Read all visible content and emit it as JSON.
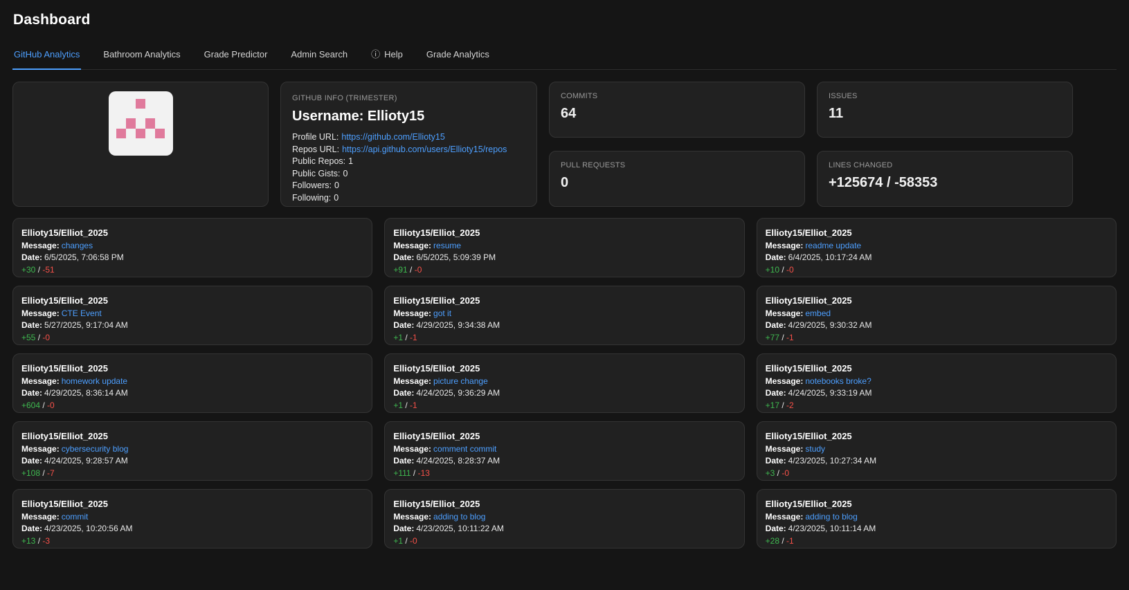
{
  "page": {
    "title": "Dashboard"
  },
  "icons": {
    "info": "ⓘ"
  },
  "tabs": [
    {
      "label": "GitHub Analytics",
      "active": true
    },
    {
      "label": "Bathroom Analytics"
    },
    {
      "label": "Grade Predictor"
    },
    {
      "label": "Admin Search"
    },
    {
      "label": "Help",
      "icon": "info"
    },
    {
      "label": "Grade Analytics"
    }
  ],
  "avatar": {
    "pattern": [
      [
        0,
        0,
        1,
        0,
        0
      ],
      [
        0,
        0,
        0,
        0,
        0
      ],
      [
        0,
        1,
        0,
        1,
        0
      ],
      [
        1,
        0,
        1,
        0,
        1
      ],
      [
        0,
        0,
        0,
        0,
        0
      ]
    ]
  },
  "github_info": {
    "card_label": "GITHUB INFO (TRIMESTER)",
    "username": "Username: Ellioty15",
    "fields": [
      {
        "label": "Profile URL:",
        "value": "https://github.com/Ellioty15",
        "is_link": true
      },
      {
        "label": "Repos URL:",
        "value": "https://api.github.com/users/Ellioty15/repos",
        "is_link": true
      },
      {
        "label": "Public Repos:",
        "value": "1"
      },
      {
        "label": "Public Gists:",
        "value": "0"
      },
      {
        "label": "Followers:",
        "value": "0"
      },
      {
        "label": "Following:",
        "value": "0"
      }
    ]
  },
  "stats": [
    {
      "label": "COMMITS",
      "value": "64"
    },
    {
      "label": "PULL REQUESTS",
      "value": "0"
    },
    {
      "label": "ISSUES",
      "value": "11"
    },
    {
      "label": "LINES CHANGED",
      "value": "+125674 / -58353"
    }
  ],
  "commit_labels": {
    "message": "Message:",
    "date": "Date:",
    "separator": "/"
  },
  "commits": [
    {
      "repo": "Ellioty15/Elliot_2025",
      "message": "changes",
      "date": "6/5/2025, 7:06:58 PM",
      "additions": "+30",
      "deletions": "-51"
    },
    {
      "repo": "Ellioty15/Elliot_2025",
      "message": "resume",
      "date": "6/5/2025, 5:09:39 PM",
      "additions": "+91",
      "deletions": "-0"
    },
    {
      "repo": "Ellioty15/Elliot_2025",
      "message": "readme update",
      "date": "6/4/2025, 10:17:24 AM",
      "additions": "+10",
      "deletions": "-0"
    },
    {
      "repo": "Ellioty15/Elliot_2025",
      "message": "CTE Event",
      "date": "5/27/2025, 9:17:04 AM",
      "additions": "+55",
      "deletions": "-0"
    },
    {
      "repo": "Ellioty15/Elliot_2025",
      "message": "got it",
      "date": "4/29/2025, 9:34:38 AM",
      "additions": "+1",
      "deletions": "-1"
    },
    {
      "repo": "Ellioty15/Elliot_2025",
      "message": "embed",
      "date": "4/29/2025, 9:30:32 AM",
      "additions": "+77",
      "deletions": "-1"
    },
    {
      "repo": "Ellioty15/Elliot_2025",
      "message": "homework update",
      "date": "4/29/2025, 8:36:14 AM",
      "additions": "+604",
      "deletions": "-0"
    },
    {
      "repo": "Ellioty15/Elliot_2025",
      "message": "picture change",
      "date": "4/24/2025, 9:36:29 AM",
      "additions": "+1",
      "deletions": "-1"
    },
    {
      "repo": "Ellioty15/Elliot_2025",
      "message": "notebooks broke?",
      "date": "4/24/2025, 9:33:19 AM",
      "additions": "+17",
      "deletions": "-2"
    },
    {
      "repo": "Ellioty15/Elliot_2025",
      "message": "cybersecurity blog",
      "date": "4/24/2025, 9:28:57 AM",
      "additions": "+108",
      "deletions": "-7"
    },
    {
      "repo": "Ellioty15/Elliot_2025",
      "message": "comment commit",
      "date": "4/24/2025, 8:28:37 AM",
      "additions": "+111",
      "deletions": "-13"
    },
    {
      "repo": "Ellioty15/Elliot_2025",
      "message": "study",
      "date": "4/23/2025, 10:27:34 AM",
      "additions": "+3",
      "deletions": "-0"
    },
    {
      "repo": "Ellioty15/Elliot_2025",
      "message": "commit",
      "date": "4/23/2025, 10:20:56 AM",
      "additions": "+13",
      "deletions": "-3"
    },
    {
      "repo": "Ellioty15/Elliot_2025",
      "message": "adding to blog",
      "date": "4/23/2025, 10:11:22 AM",
      "additions": "+1",
      "deletions": "-0"
    },
    {
      "repo": "Ellioty15/Elliot_2025",
      "message": "adding to blog",
      "date": "4/23/2025, 10:11:14 AM",
      "additions": "+28",
      "deletions": "-1"
    }
  ],
  "colors": {
    "accent_blue": "#4d9fff",
    "additions_green": "#3fb950",
    "deletions_red": "#f85149",
    "identicon_pink": "#e07a9c",
    "identicon_bg": "#f2f2f2"
  }
}
